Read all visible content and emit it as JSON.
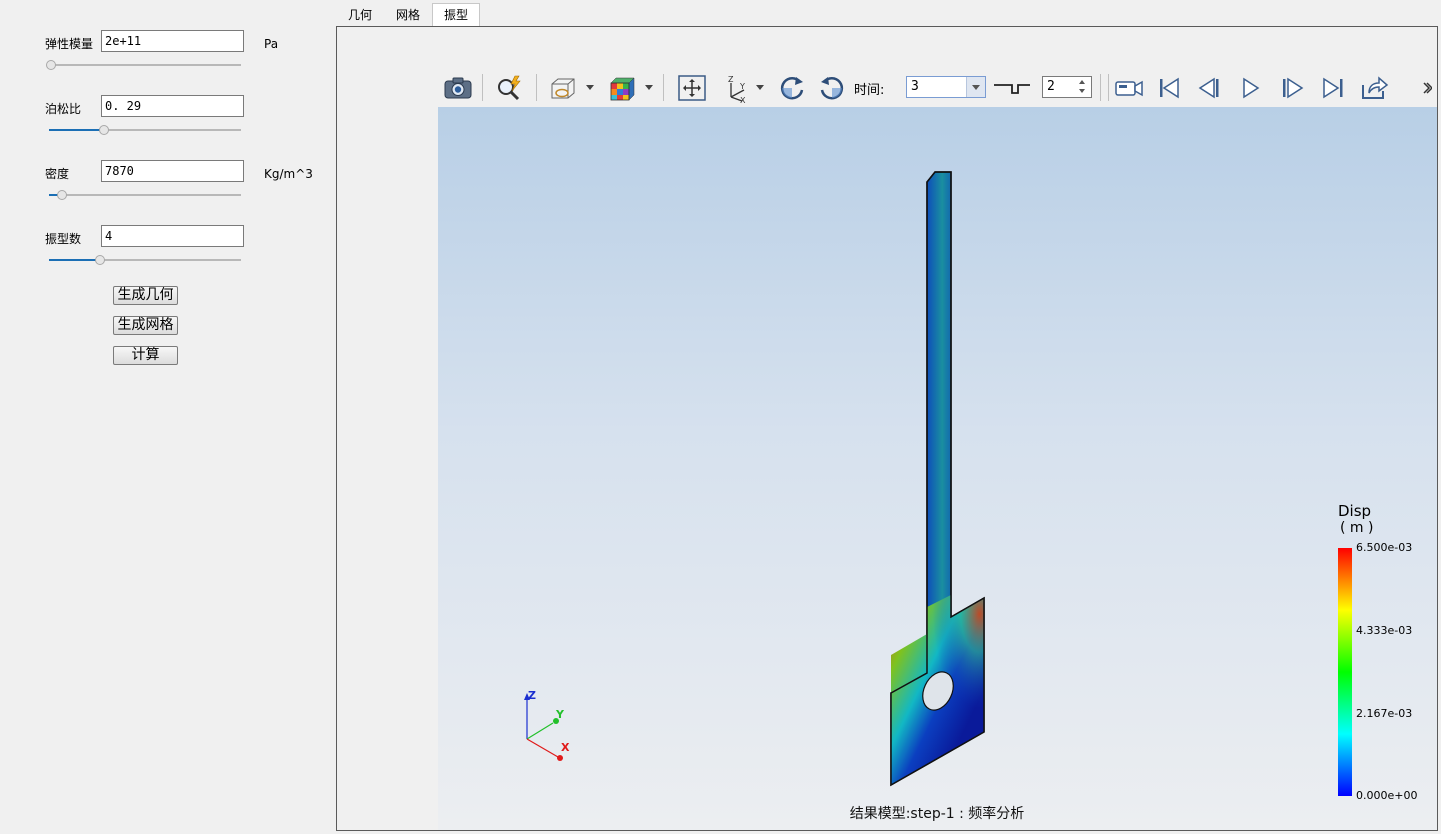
{
  "params": {
    "modulus": {
      "label": "弹性模量",
      "value": "2e+11",
      "unit": "Pa",
      "slider_fraction": 0.0
    },
    "poisson": {
      "label": "泊松比",
      "value": "0. 29",
      "slider_fraction": 0.28
    },
    "density": {
      "label": "密度",
      "value": "7870",
      "unit": "Kg/m^3",
      "slider_fraction": 0.06
    },
    "modes": {
      "label": "振型数",
      "value": "4",
      "slider_fraction": 0.26
    }
  },
  "buttons": {
    "geometry": "生成几何",
    "mesh": "生成网格",
    "compute": "计算"
  },
  "tabs": [
    {
      "label": "几何",
      "active": false
    },
    {
      "label": "网格",
      "active": false
    },
    {
      "label": "振型",
      "active": true
    }
  ],
  "toolbar": {
    "time_label": "时间:",
    "time_value": "3",
    "step_value": "2",
    "icons": [
      "camera-icon",
      "zoom-icon",
      "clip-box-icon",
      "color-cube-icon",
      "fit-view-icon",
      "axes-icon",
      "rotate-cw-icon",
      "rotate-ccw-icon",
      "step-icon",
      "record-icon",
      "first-frame-icon",
      "prev-frame-icon",
      "play-icon",
      "next-frame-icon",
      "last-frame-icon",
      "export-icon"
    ]
  },
  "legend": {
    "title": "Disp",
    "unit": "( m )",
    "ticks": [
      "6.500e-03",
      "4.333e-03",
      "2.167e-03",
      "0.000e+00"
    ],
    "colors": [
      "#ff0000",
      "#ffff00",
      "#00ff00",
      "#00ffff",
      "#0000ff"
    ]
  },
  "axes": {
    "z": "Z",
    "y": "Y",
    "x": "X"
  },
  "footer": "结果模型:step-1 : 频率分析"
}
